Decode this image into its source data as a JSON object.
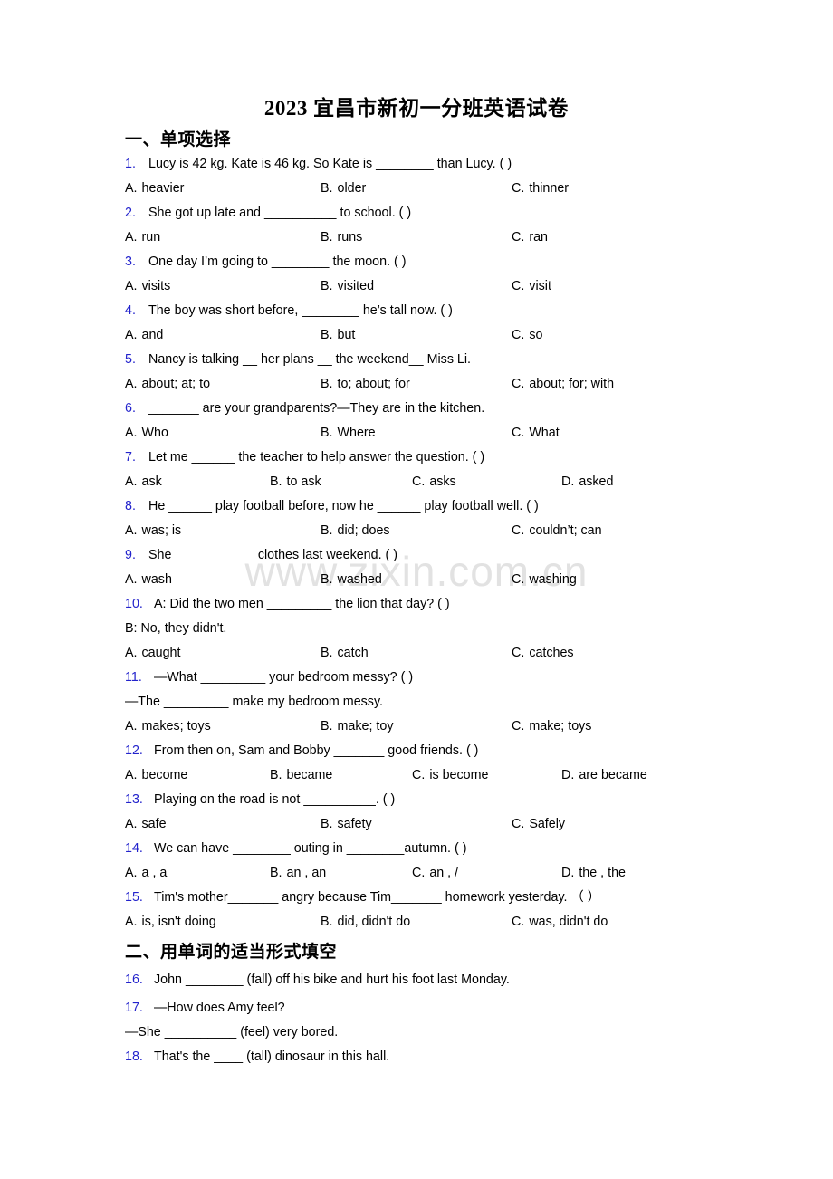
{
  "watermark": "www.zixin.com.cn",
  "document": {
    "title": "2023 宜昌市新初一分班英语试卷"
  },
  "sections": [
    {
      "heading": "一、单项选择"
    },
    {
      "heading": "二、用单词的适当形式填空"
    }
  ],
  "questions": [
    {
      "number": "1.",
      "text": "Lucy is 42 kg. Kate is 46 kg. So Kate is ________ than Lucy. (    )",
      "options": [
        {
          "letter": "A.",
          "text": "heavier"
        },
        {
          "letter": "B.",
          "text": "older"
        },
        {
          "letter": "C.",
          "text": "thinner"
        }
      ]
    },
    {
      "number": "2.",
      "text": "She got up late and __________ to school. (    )",
      "options": [
        {
          "letter": "A.",
          "text": "run"
        },
        {
          "letter": "B.",
          "text": "runs"
        },
        {
          "letter": "C.",
          "text": "ran"
        }
      ]
    },
    {
      "number": "3.",
      "text": "One day I’m going to ________ the moon. (    )",
      "options": [
        {
          "letter": "A.",
          "text": "visits"
        },
        {
          "letter": "B.",
          "text": "visited"
        },
        {
          "letter": "C.",
          "text": "visit"
        }
      ]
    },
    {
      "number": "4.",
      "text": "The boy was short before, ________ he’s tall now. (    )",
      "options": [
        {
          "letter": "A.",
          "text": "and"
        },
        {
          "letter": "B.",
          "text": "but"
        },
        {
          "letter": "C.",
          "text": "so"
        }
      ]
    },
    {
      "number": "5.",
      "text": "Nancy is talking __ her plans __ the weekend__ Miss Li.",
      "options": [
        {
          "letter": "A.",
          "text": "about; at; to"
        },
        {
          "letter": "B.",
          "text": "to; about; for"
        },
        {
          "letter": "C.",
          "text": "about; for; with"
        }
      ]
    },
    {
      "number": "6.",
      "text": "_______ are your grandparents?—They are in the kitchen.",
      "options": [
        {
          "letter": "A.",
          "text": "Who"
        },
        {
          "letter": "B.",
          "text": "Where"
        },
        {
          "letter": "C.",
          "text": "What"
        }
      ]
    },
    {
      "number": "7.",
      "text": "Let me ______ the teacher to help answer the question. (    )",
      "options": [
        {
          "letter": "A.",
          "text": "ask"
        },
        {
          "letter": "B.",
          "text": "to ask"
        },
        {
          "letter": "C.",
          "text": "asks"
        },
        {
          "letter": "D.",
          "text": "asked"
        }
      ]
    },
    {
      "number": "8.",
      "text": "He ______ play football before, now he ______ play football well. (    )",
      "options": [
        {
          "letter": "A.",
          "text": "was; is"
        },
        {
          "letter": "B.",
          "text": "did; does"
        },
        {
          "letter": "C.",
          "text": "couldn’t; can"
        }
      ]
    },
    {
      "number": "9.",
      "text": "She ___________ clothes last weekend. (     )",
      "options": [
        {
          "letter": "A.",
          "text": "wash"
        },
        {
          "letter": "B.",
          "text": "washed"
        },
        {
          "letter": "C.",
          "text": "washing"
        }
      ]
    },
    {
      "number": "10.",
      "text": "A: Did the two men _________ the lion that day? (    )",
      "continuation": "B: No, they didn't.",
      "options": [
        {
          "letter": "A.",
          "text": "caught"
        },
        {
          "letter": "B.",
          "text": "catch"
        },
        {
          "letter": "C.",
          "text": "catches"
        }
      ]
    },
    {
      "number": "11.",
      "text": "—What _________ your bedroom messy? (    )",
      "continuation": "—The _________ make my bedroom messy.",
      "options": [
        {
          "letter": "A.",
          "text": "makes; toys"
        },
        {
          "letter": "B.",
          "text": "make; toy"
        },
        {
          "letter": "C.",
          "text": "make; toys"
        }
      ]
    },
    {
      "number": "12.",
      "text": "From then on, Sam and Bobby _______ good friends. (  )",
      "options": [
        {
          "letter": "A.",
          "text": "become"
        },
        {
          "letter": "B.",
          "text": "became"
        },
        {
          "letter": "C.",
          "text": "is become"
        },
        {
          "letter": "D.",
          "text": "are became"
        }
      ]
    },
    {
      "number": "13.",
      "text": "Playing on the road is not __________. (  )",
      "options": [
        {
          "letter": "A.",
          "text": "safe"
        },
        {
          "letter": "B.",
          "text": "safety"
        },
        {
          "letter": "C.",
          "text": "Safely"
        }
      ]
    },
    {
      "number": "14.",
      "text": "We can have ________ outing in ________autumn. (  )",
      "options": [
        {
          "letter": "A.",
          "text": "a , a"
        },
        {
          "letter": "B.",
          "text": "an , an"
        },
        {
          "letter": "C.",
          "text": "an , /"
        },
        {
          "letter": "D.",
          "text": "the , the"
        }
      ]
    },
    {
      "number": "15.",
      "text": "Tim's mother_______ angry because Tim_______ homework yesterday. （    ）",
      "options": [
        {
          "letter": "A.",
          "text": "is, isn't doing"
        },
        {
          "letter": "B.",
          "text": "did, didn't do"
        },
        {
          "letter": "C.",
          "text": "was, didn't do"
        }
      ]
    },
    {
      "number": "16.",
      "text": "John ________ (fall) off his bike and hurt his foot last Monday.",
      "options": []
    },
    {
      "number": "17.",
      "text": "—How does Amy feel?",
      "continuation": "—She __________ (feel) very bored.",
      "options": []
    },
    {
      "number": "18.",
      "text": "That's the ____ (tall) dinosaur in this hall.",
      "options": []
    }
  ]
}
